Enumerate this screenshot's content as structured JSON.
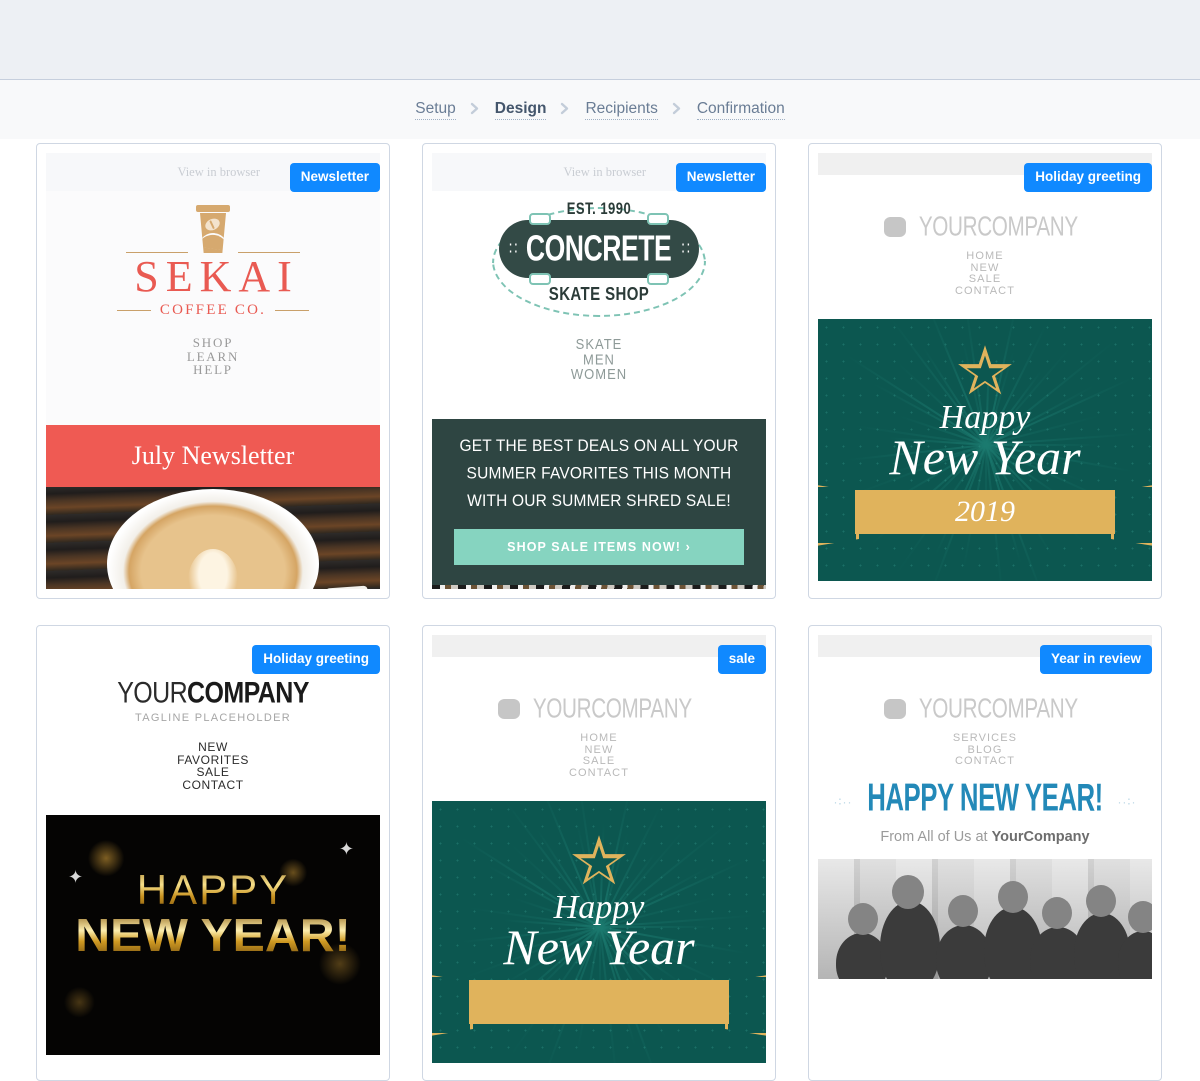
{
  "breadcrumb": {
    "items": [
      {
        "label": "Setup",
        "current": false
      },
      {
        "label": "Design",
        "current": true
      },
      {
        "label": "Recipients",
        "current": false
      },
      {
        "label": "Confirmation",
        "current": false
      }
    ]
  },
  "colors": {
    "badge_blue": "#1089ff",
    "sekai_red": "#e95a52",
    "july_banner": "#ef5a53",
    "concrete_dark": "#2e4542",
    "concrete_teal_btn": "#86d4c0",
    "newyear_teal": "#0c5750",
    "newyear_gold": "#e0b35c",
    "blue_headline": "#2389b8",
    "page_top_band": "#edf0f4",
    "breadcrumb_band": "#f8f9fa",
    "card_border": "#cfd7e3"
  },
  "templates": [
    {
      "id": "sekai-coffee",
      "badge": "Newsletter",
      "view_in_browser": "View in browser",
      "brand_name": "SEKAI",
      "brand_sub": "COFFEE CO.",
      "nav": [
        "SHOP",
        "LEARN",
        "HELP"
      ],
      "banner_title": "July Newsletter",
      "logo_icon": "coffee-cup-icon",
      "hero_image": "latte-art-coffee-cup-on-wood-photo"
    },
    {
      "id": "concrete-skate-shop",
      "badge": "Newsletter",
      "view_in_browser": "View in browser",
      "est_line": "EST. 1990",
      "brand_name": "CONCRETE",
      "brand_sub": "SKATE SHOP",
      "nav": [
        "SKATE",
        "MEN",
        "WOMEN"
      ],
      "promo_text": "GET THE BEST DEALS ON ALL YOUR SUMMER FAVORITES THIS MONTH WITH OUR SUMMER SHRED SALE!",
      "cta_label": "SHOP SALE ITEMS NOW! ›",
      "logo_icon": "skateboard-deck-icon",
      "hero_image": "snowy-street-photo-strip"
    },
    {
      "id": "holiday-greeting-teal",
      "badge": "Holiday greeting",
      "brand_name": "YOURCOMPANY",
      "nav": [
        "HOME",
        "NEW",
        "SALE",
        "CONTACT"
      ],
      "hero_headline_small": "Happy",
      "hero_headline_large": "New Year",
      "hero_year": "2019",
      "logo_icon": "yourcompany-four-petal-icon",
      "hero_image": "teal-starburst-happy-new-year-2019-graphic"
    },
    {
      "id": "holiday-greeting-black-gold",
      "badge": "Holiday greeting",
      "brand_name_light": "YOUR",
      "brand_name_bold": "COMPANY",
      "tagline": "TAGLINE PLACEHOLDER",
      "nav": [
        "NEW",
        "FAVORITES",
        "SALE",
        "CONTACT"
      ],
      "hero_headline_top": "HAPPY",
      "hero_headline_bottom": "NEW YEAR!",
      "logo_icon": "wordmark-icon",
      "hero_image": "gold-bokeh-happy-new-year-graphic"
    },
    {
      "id": "sale-teal-newyear",
      "badge": "sale",
      "brand_name": "YOURCOMPANY",
      "nav": [
        "HOME",
        "NEW",
        "SALE",
        "CONTACT"
      ],
      "hero_headline_small": "Happy",
      "hero_headline_large": "New Year",
      "logo_icon": "yourcompany-four-petal-icon",
      "hero_image": "teal-starburst-happy-new-year-graphic"
    },
    {
      "id": "year-in-review",
      "badge": "Year in review",
      "brand_name": "YOURCOMPANY",
      "nav": [
        "SERVICES",
        "BLOG",
        "CONTACT"
      ],
      "hero_headline": "HAPPY NEW YEAR!",
      "hero_sparkles_left": "·∶··",
      "hero_sparkles_right": "··∶·",
      "from_prefix": "From All of Us at ",
      "from_company": "YourCompany",
      "logo_icon": "yourcompany-four-petal-icon",
      "hero_image": "black-and-white-team-group-photo"
    }
  ]
}
